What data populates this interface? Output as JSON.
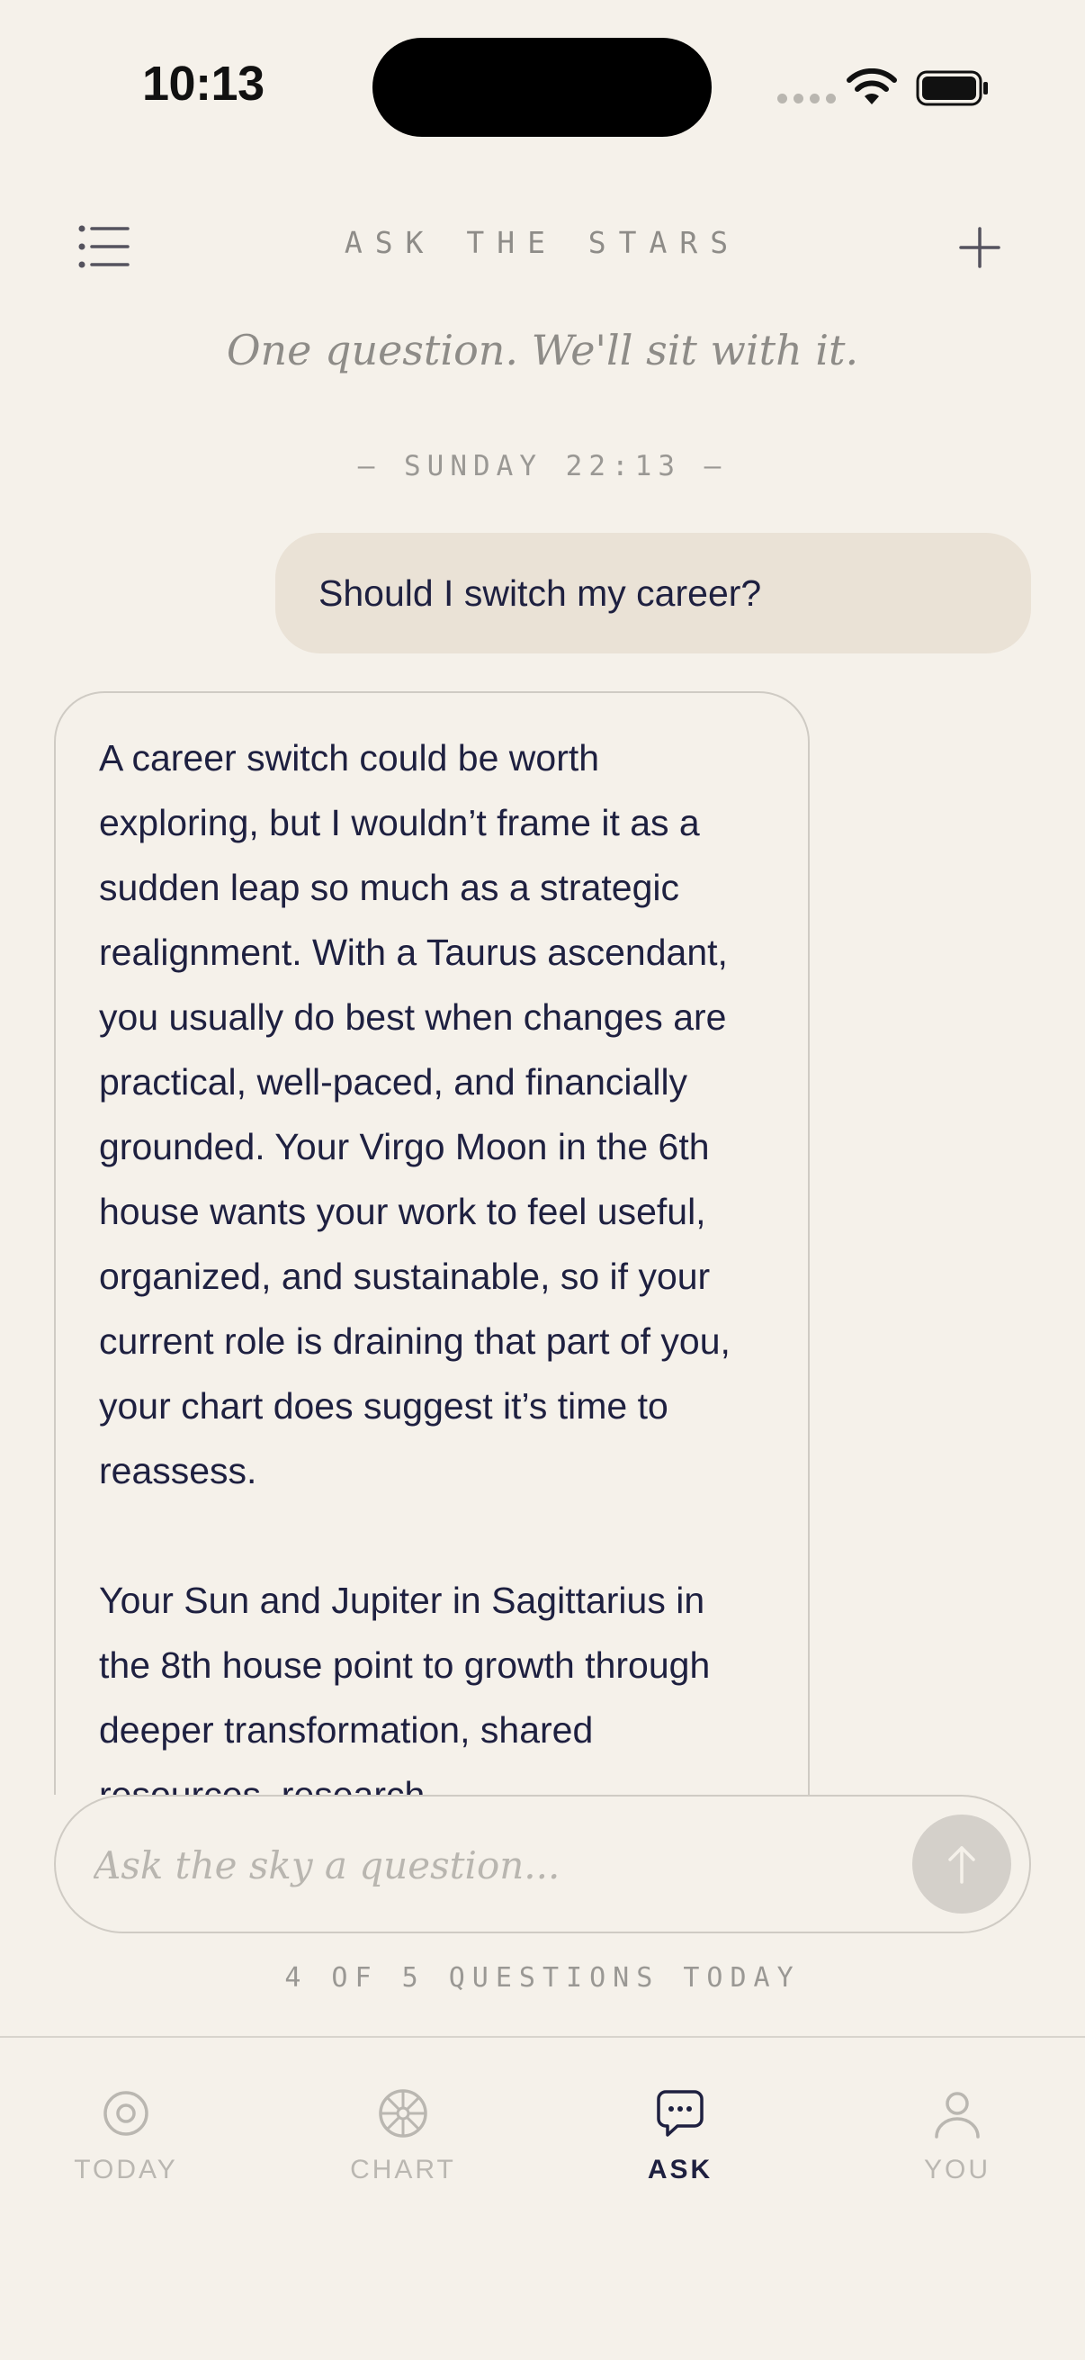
{
  "status_bar": {
    "time": "10:13"
  },
  "header": {
    "title": "ASK THE STARS",
    "subtitle": "One question. We'll sit with it.",
    "menu_icon": "list-icon",
    "new_icon": "plus-icon"
  },
  "conversation": {
    "timestamp": "— SUNDAY 22:13 —",
    "user_message": "Should I switch my career?",
    "assistant_paragraphs": [
      "A career switch could be worth exploring, but I wouldn’t frame it as a sudden leap so much as a strategic realignment. With a Taurus ascendant, you usually do best when changes are practical, well-paced, and financially grounded. Your Virgo Moon in the 6th house wants your work to feel useful, organized, and sustainable, so if your current role is draining that part of you, your chart does suggest it’s time to reassess.",
      "Your Sun and Jupiter in Sagittarius in the 8th house point to growth through deeper transformation, shared resources, research"
    ]
  },
  "composer": {
    "placeholder": "Ask the sky a question...",
    "send_icon": "arrow-up-icon",
    "quota": "4 OF 5 QUESTIONS TODAY"
  },
  "tabs": [
    {
      "label": "TODAY",
      "icon": "target-icon",
      "active": false
    },
    {
      "label": "CHART",
      "icon": "wheel-icon",
      "active": false
    },
    {
      "label": "ASK",
      "icon": "chat-bubble-icon",
      "active": true
    },
    {
      "label": "YOU",
      "icon": "person-icon",
      "active": false
    }
  ],
  "colors": {
    "background": "#F5F1EA",
    "ink": "#1E2040",
    "user_bubble": "#EAE2D6",
    "muted": "#9A9894",
    "inactive_tab": "#BAB7B1"
  }
}
